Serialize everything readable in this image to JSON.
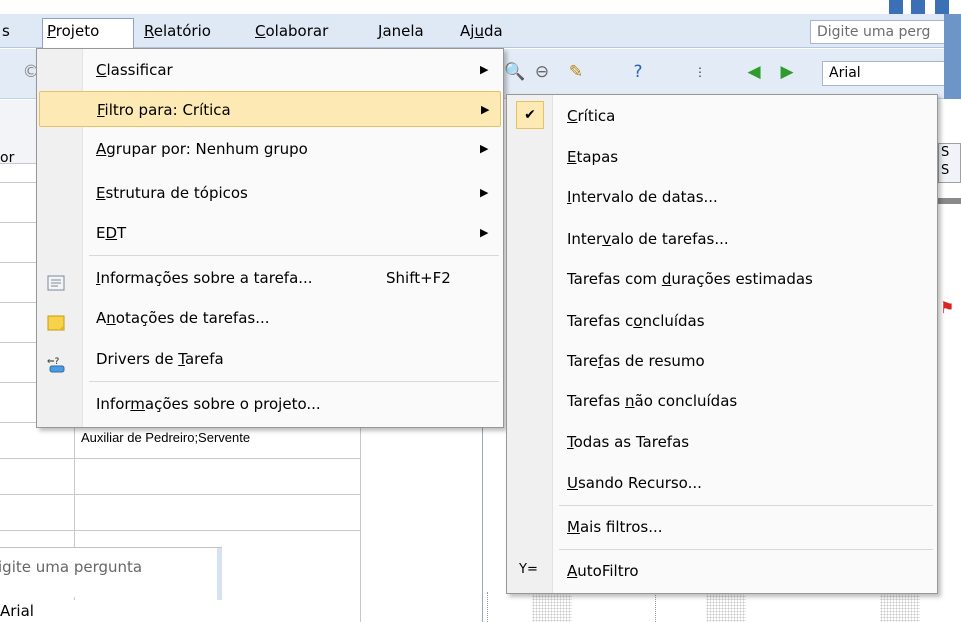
{
  "menubar": {
    "items": [
      {
        "label": "s"
      },
      {
        "label": "Projeto"
      },
      {
        "label": "Relatório"
      },
      {
        "label": "Colaborar"
      },
      {
        "label": "Janela"
      },
      {
        "label": "Ajuda"
      }
    ],
    "help_placeholder": "Digite uma perg"
  },
  "toolbar": {
    "font_value": "Arial"
  },
  "grid": {
    "cell_resources": "Auxiliar de Pedreiro;Servente",
    "header_fragment": "or",
    "gantt_header_fragment": "S\nS"
  },
  "floating": {
    "help_placeholder": "igite uma pergunta",
    "font_value": "Arial"
  },
  "project_menu": {
    "items": [
      {
        "label": "Classificar",
        "submenu": true
      },
      {
        "label": "Filtro para: Crítica",
        "submenu": true,
        "highlighted": true
      },
      {
        "label": "Agrupar por: Nenhum grupo",
        "submenu": true
      },
      {
        "label": "Estrutura de tópicos",
        "submenu": true
      },
      {
        "label": "EDT",
        "submenu": true
      },
      {
        "label": "Informações sobre a tarefa...",
        "shortcut": "Shift+F2",
        "icon": "task-info-icon"
      },
      {
        "label": "Anotações de tarefas...",
        "icon": "task-notes-icon"
      },
      {
        "label": "Drivers de Tarefa",
        "icon": "task-drivers-icon"
      },
      {
        "label": "Informações sobre o projeto..."
      }
    ]
  },
  "filter_submenu": {
    "items": [
      {
        "label": "Crítica",
        "checked": true
      },
      {
        "label": "Etapas"
      },
      {
        "label": "Intervalo de datas..."
      },
      {
        "label": "Intervalo de tarefas..."
      },
      {
        "label": "Tarefas com durações estimadas"
      },
      {
        "label": "Tarefas concluídas"
      },
      {
        "label": "Tarefas de resumo"
      },
      {
        "label": "Tarefas não concluídas"
      },
      {
        "label": "Todas as Tarefas"
      },
      {
        "label": "Usando Recurso..."
      },
      {
        "label": "Mais filtros..."
      },
      {
        "label": "AutoFiltro",
        "icon": "autofilter-icon"
      }
    ]
  },
  "colors": {
    "highlight": "#fde9b4",
    "highlight_border": "#e5c365",
    "menubar": "#dfe8f5"
  }
}
